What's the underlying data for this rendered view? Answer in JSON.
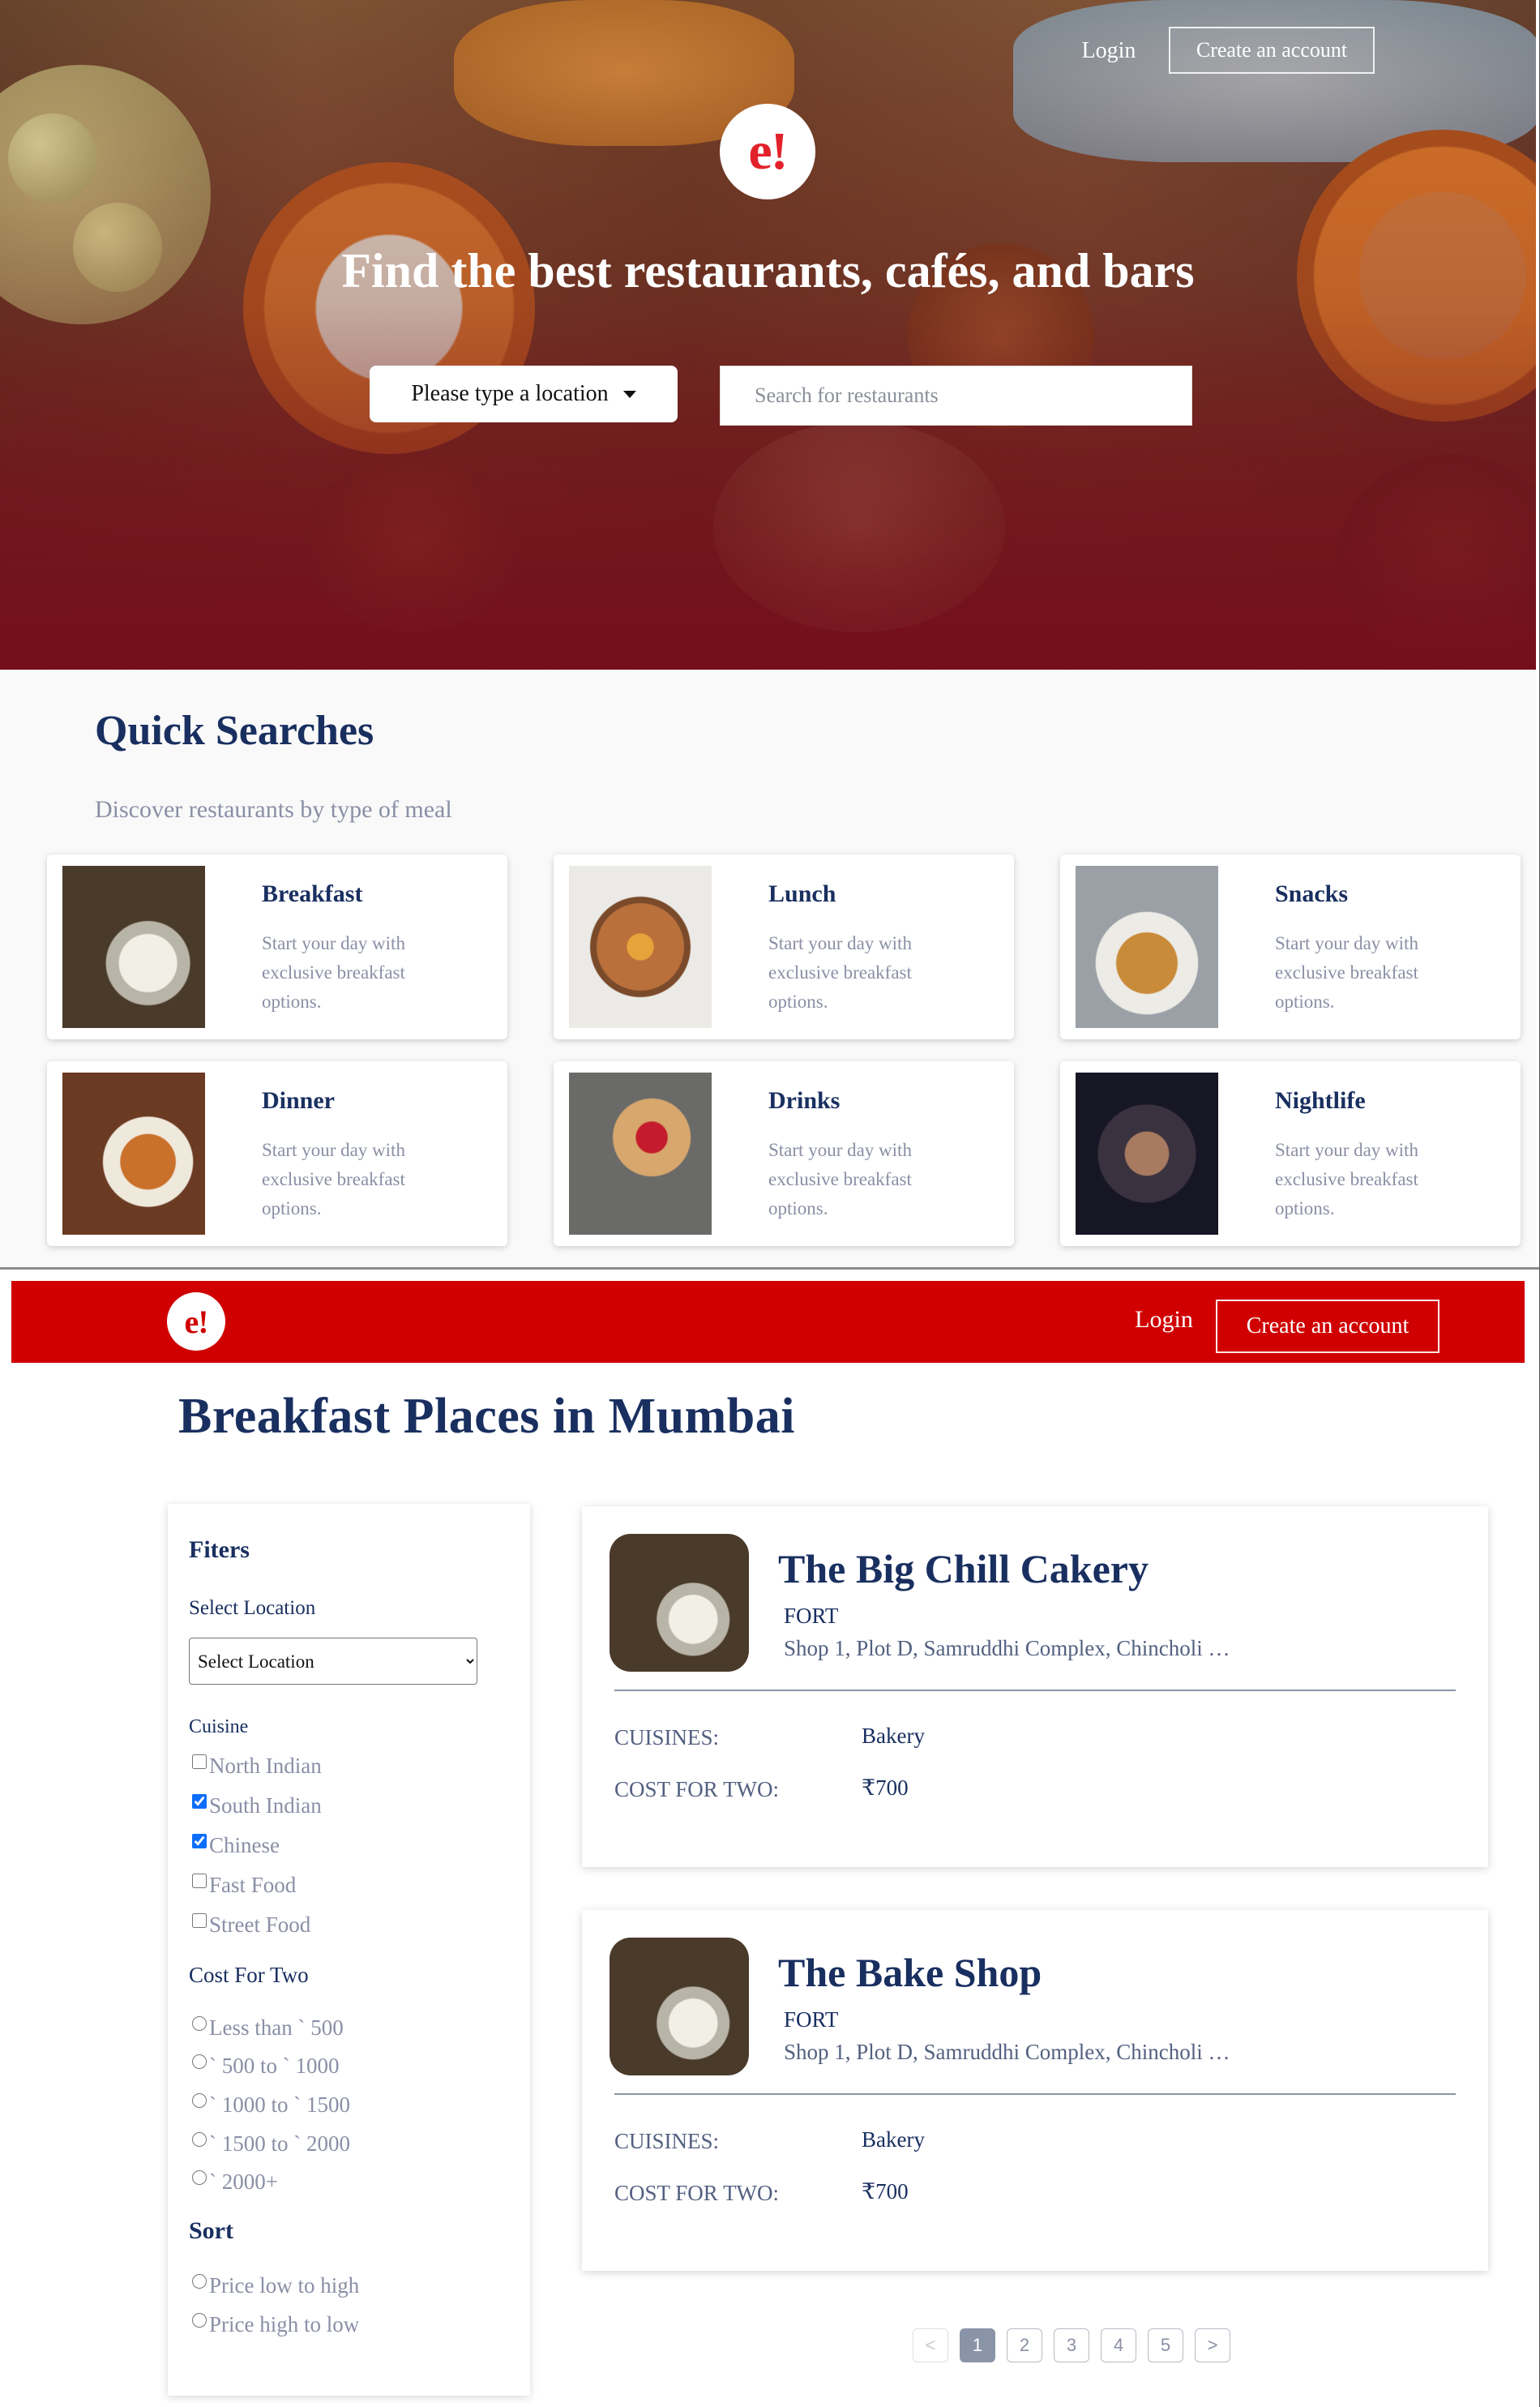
{
  "hero": {
    "login_label": "Login",
    "create_account_label": "Create an account",
    "logo_text": "e!",
    "title": "Find the best restaurants, cafés, and bars",
    "location_button_label": "Please type a location",
    "search_placeholder": "Search for restaurants"
  },
  "quick_searches": {
    "title": "Quick Searches",
    "subtitle": "Discover restaurants by type of meal",
    "cards": [
      {
        "title": "Breakfast",
        "description": "Start your day with exclusive breakfast options."
      },
      {
        "title": "Lunch",
        "description": "Start your day with exclusive breakfast options."
      },
      {
        "title": "Snacks",
        "description": "Start your day with exclusive breakfast options."
      },
      {
        "title": "Dinner",
        "description": "Start your day with exclusive breakfast options."
      },
      {
        "title": "Drinks",
        "description": "Start your day with exclusive breakfast options."
      },
      {
        "title": "Nightlife",
        "description": "Start your day with exclusive breakfast options."
      }
    ]
  },
  "navbar": {
    "logo_text": "e!",
    "login_label": "Login",
    "create_account_label": "Create an account",
    "bg_color": "#d00000"
  },
  "page_title": "Breakfast Places in Mumbai",
  "filters": {
    "heading": "Fiters",
    "location_label": "Select Location",
    "location_selected": "Select Location",
    "cuisine_label": "Cuisine",
    "cuisines": [
      {
        "label": "North Indian",
        "checked": false
      },
      {
        "label": "South Indian",
        "checked": true
      },
      {
        "label": "Chinese",
        "checked": true
      },
      {
        "label": "Fast Food",
        "checked": false
      },
      {
        "label": "Street Food",
        "checked": false
      }
    ],
    "cost_label": "Cost For Two",
    "costs": [
      "Less than ` 500",
      "` 500 to ` 1000",
      "` 1000 to ` 1500",
      "` 1500 to ` 2000",
      "` 2000+"
    ],
    "sort_heading": "Sort",
    "sorts": [
      "Price low to high",
      "Price high to low"
    ]
  },
  "results": [
    {
      "name": "The Big Chill Cakery",
      "area": "FORT",
      "address": "Shop 1, Plot D, Samruddhi Complex, Chincholi …",
      "cuisines_label": "CUISINES:",
      "cuisines_value": "Bakery",
      "cost_label": "COST FOR TWO:",
      "cost_value": "₹700"
    },
    {
      "name": "The Bake Shop",
      "area": "FORT",
      "address": "Shop 1, Plot D, Samruddhi Complex, Chincholi …",
      "cuisines_label": "CUISINES:",
      "cuisines_value": "Bakery",
      "cost_label": "COST FOR TWO:",
      "cost_value": "₹700"
    }
  ],
  "pagination": {
    "prev": "<",
    "pages": [
      "1",
      "2",
      "3",
      "4",
      "5"
    ],
    "next": ">",
    "active": "1"
  },
  "colors": {
    "brand_red": "#d00000",
    "navy": "#192f60",
    "muted": "#8a8fa5"
  }
}
